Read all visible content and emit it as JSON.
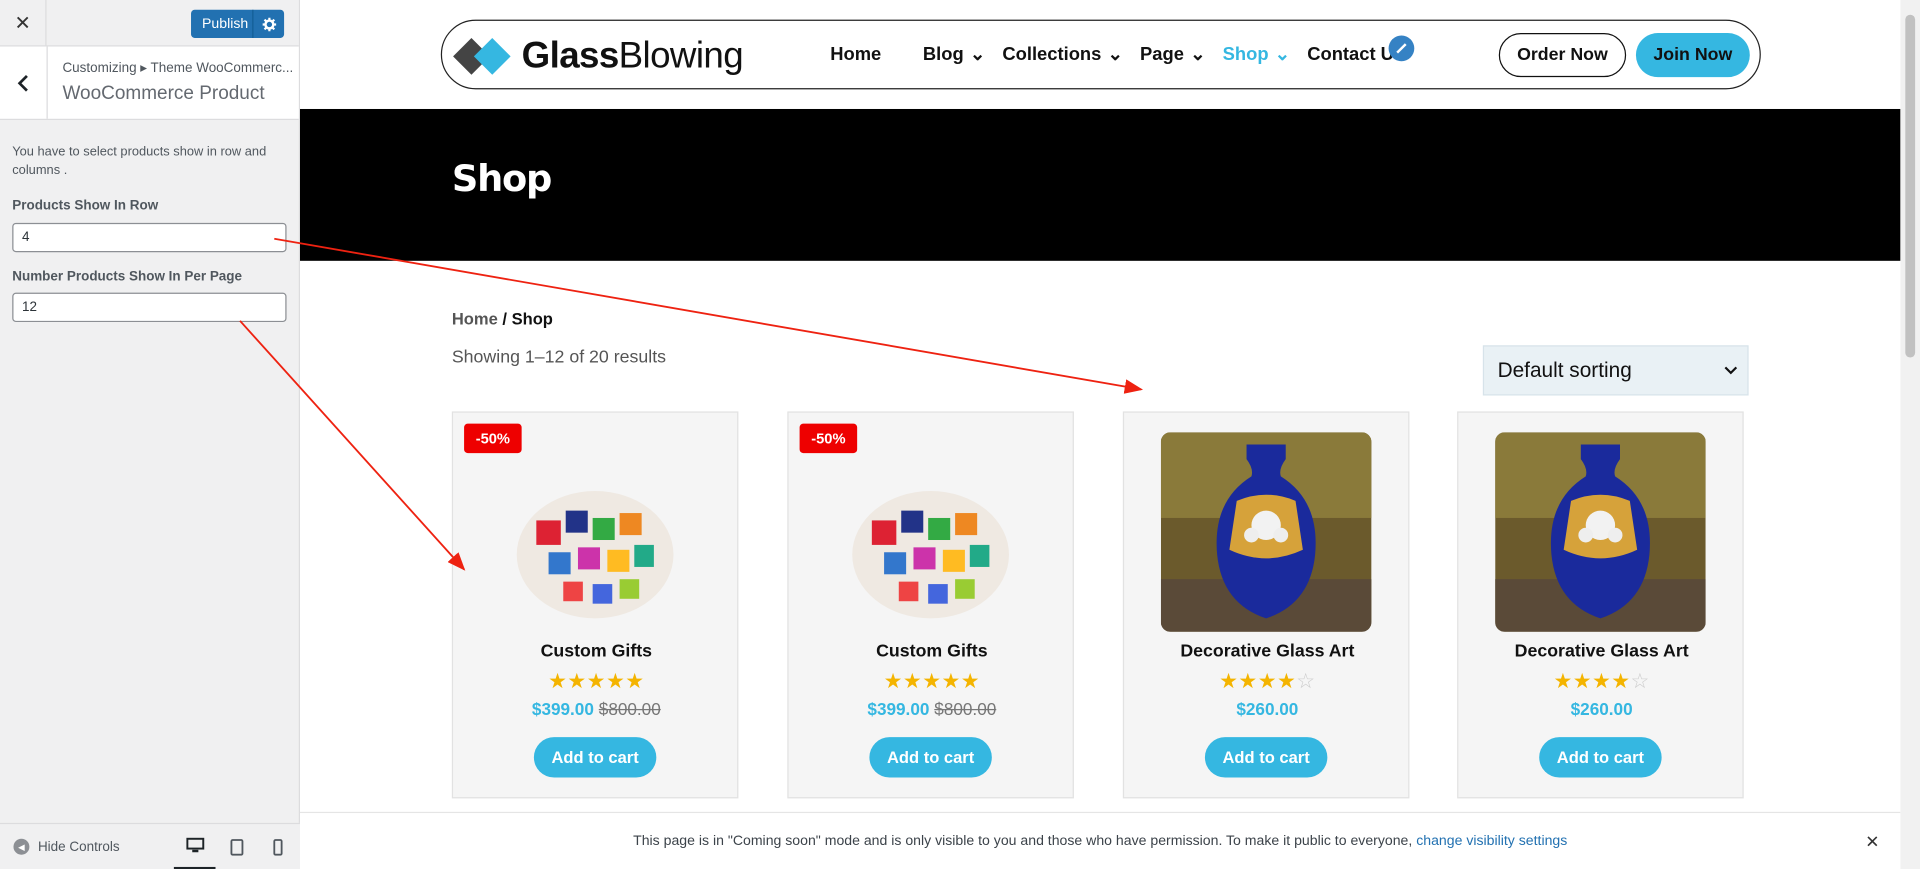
{
  "customizer": {
    "close_icon": "close-icon",
    "publish_label": "Publish",
    "breadcrumb": "Customizing ▸ Theme WooCommerc...",
    "section_title": "WooCommerce Product",
    "description": "You have to select products show in row and columns .",
    "row_label": "Products Show In Row",
    "row_value": "4",
    "per_page_label": "Number Products Show In Per Page",
    "per_page_value": "12",
    "hide_controls": "Hide Controls"
  },
  "site": {
    "logo_bold": "Glass",
    "logo_rest": "Blowing",
    "nav": [
      "Home",
      "Blog",
      "Collections",
      "Page",
      "Shop",
      "Contact Us"
    ],
    "order_now": "Order Now",
    "join_now": "Join Now",
    "banner_title": "Shop",
    "breadcrumb_home": "Home",
    "breadcrumb_sep": " / ",
    "breadcrumb_current": "Shop",
    "result_count": "Showing 1–12 of 20 results",
    "sorting": "Default sorting",
    "accent": "#35b7e1"
  },
  "products": [
    {
      "title": "Custom Gifts",
      "badge": "-50%",
      "rating": 5,
      "price": "$399.00",
      "old_price": "$800.00",
      "button": "Add to cart"
    },
    {
      "title": "Custom Gifts",
      "badge": "-50%",
      "rating": 5,
      "price": "$399.00",
      "old_price": "$800.00",
      "button": "Add to cart"
    },
    {
      "title": "Decorative Glass Art",
      "badge": "",
      "rating": 4,
      "price": "$260.00",
      "old_price": "",
      "button": "Add to cart"
    },
    {
      "title": "Decorative Glass Art",
      "badge": "",
      "rating": 4,
      "price": "$260.00",
      "old_price": "",
      "button": "Add to cart"
    }
  ],
  "notice": {
    "text": "This page is in \"Coming soon\" mode and is only visible to you and those who have permission. To make it public to everyone, ",
    "link": "change visibility settings"
  }
}
